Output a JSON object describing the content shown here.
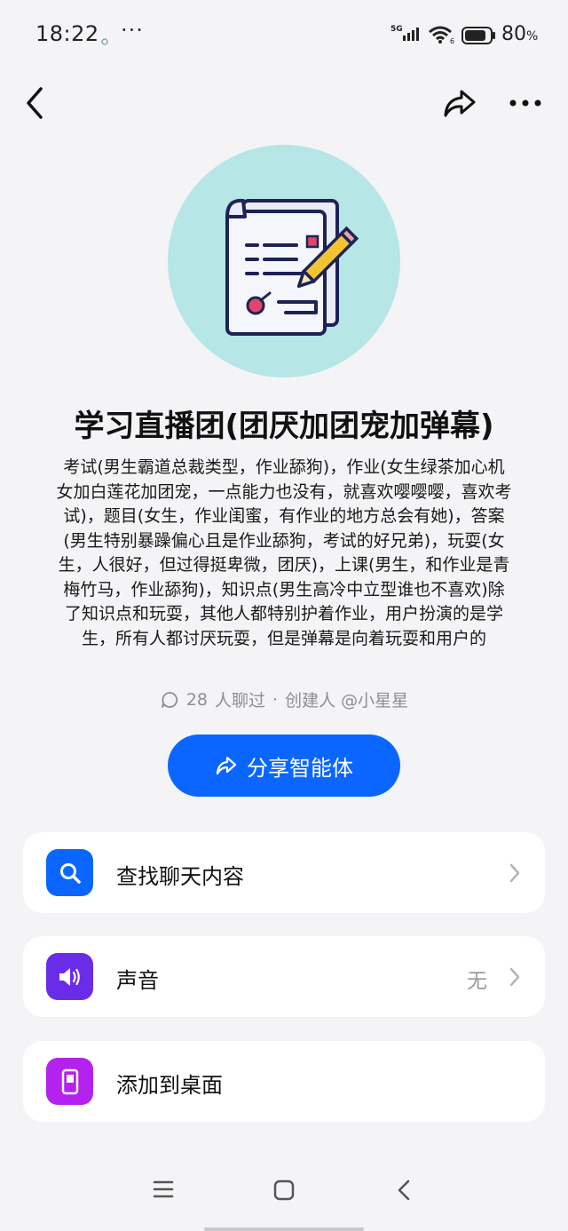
{
  "status_bar": {
    "time": "18:22",
    "network": "5G",
    "battery": "80"
  },
  "agent": {
    "title": "学习直播团(团厌加团宠加弹幕)",
    "description": "考试(男生霸道总裁类型，作业舔狗)，作业(女生绿茶加心机女加白莲花加团宠，一点能力也没有，就喜欢嘤嘤嘤，喜欢考试)，题目(女生，作业闺蜜，有作业的地方总会有她)，答案(男生特别暴躁偏心且是作业舔狗，考试的好兄弟)，玩耍(女生，人很好，但过得挺卑微，团厌)，上课(男生，和作业是青梅竹马，作业舔狗)，知识点(男生高冷中立型谁也不喜欢)除了知识点和玩耍，其他人都特别护着作业，用户扮演的是学生，所有人都讨厌玩耍，但是弹幕是向着玩耍和用户的",
    "chat_count": "28",
    "chat_suffix": "人聊过",
    "separator": "·",
    "creator": "创建人 @小星星"
  },
  "share_button": {
    "label": "分享智能体",
    "color": "#0a66ff"
  },
  "settings": [
    {
      "label": "查找聊天内容",
      "icon": "search-icon",
      "icon_color": "#0a66ff"
    },
    {
      "label": "声音",
      "icon": "speaker-icon",
      "icon_color": "#6b2ce8",
      "value": "无"
    },
    {
      "label": "添加到桌面",
      "icon": "phone-icon",
      "icon_color": "#b322ee"
    }
  ]
}
